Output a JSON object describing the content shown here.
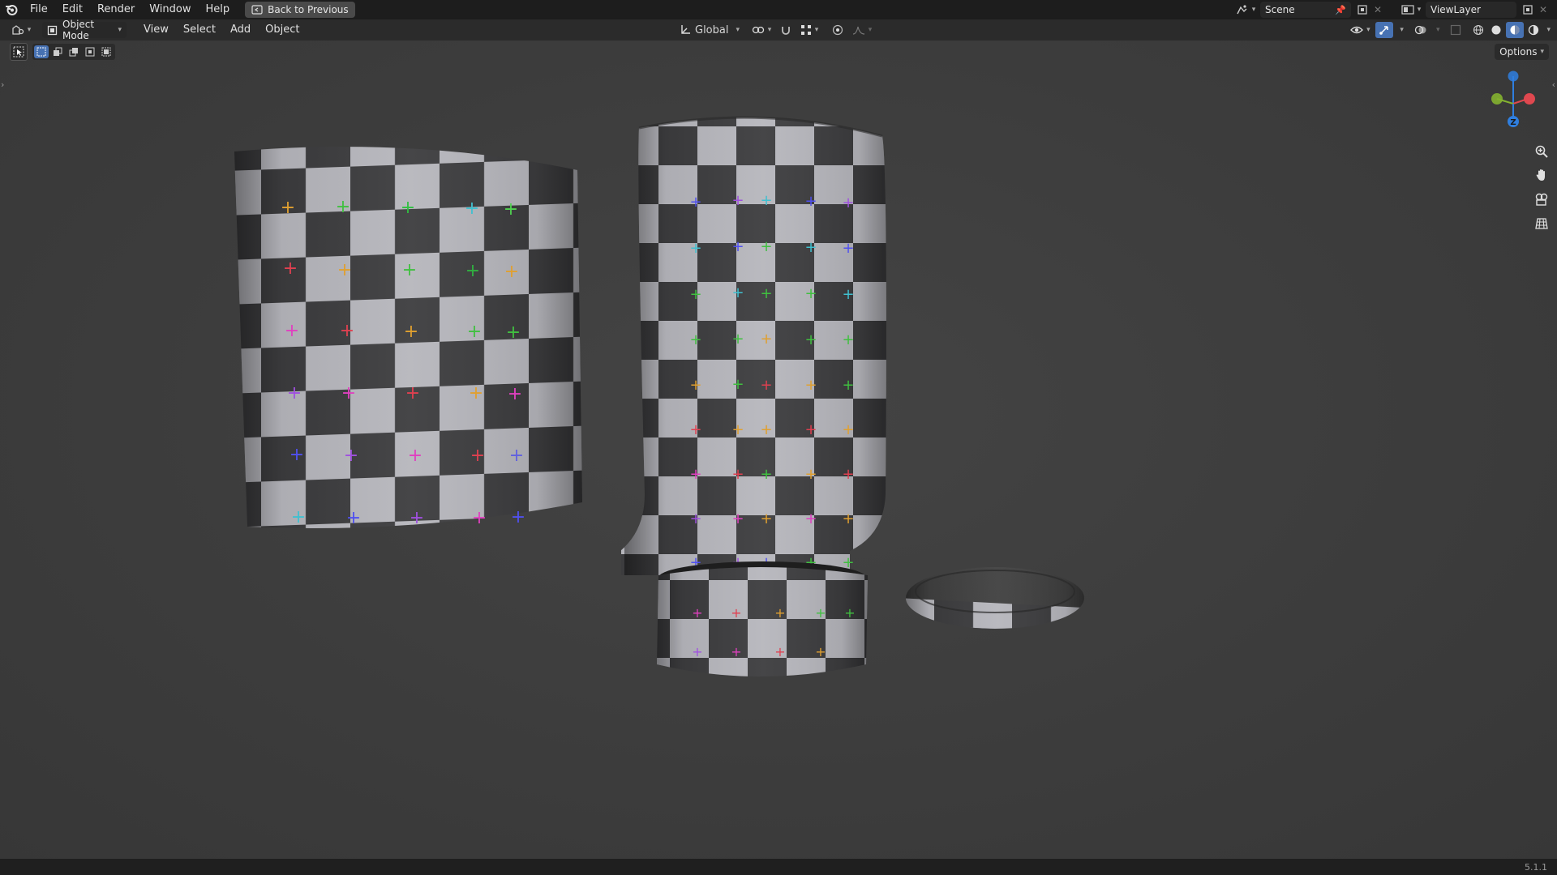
{
  "topbar": {
    "menu": [
      "File",
      "Edit",
      "Render",
      "Window",
      "Help"
    ],
    "back_button_label": "Back to Previous",
    "scene_name": "Scene",
    "view_layer_name": "ViewLayer"
  },
  "header": {
    "mode_label": "Object Mode",
    "menu": [
      "View",
      "Select",
      "Add",
      "Object"
    ],
    "orientation_label": "Global",
    "options_label": "Options"
  },
  "gizmo": {
    "z_label": "Z",
    "x_color": "#e0484f",
    "y_color": "#84b330",
    "z_color": "#2f7fe0"
  },
  "status": {
    "version": "5.1.1"
  },
  "colors": {
    "topbar_bg": "#1d1d1d",
    "header_bg": "#2b2b2b",
    "viewport_bg": "#3d3d3d",
    "checker_light": "#b9b9bf",
    "checker_dark": "#3c3c3e"
  },
  "icons": [
    "blender-logo-icon",
    "back-icon",
    "scene-icon",
    "pin-icon",
    "new-scene-icon",
    "view-layer-icon",
    "editor-type-icon",
    "object-mode-icon",
    "transform-orientation-icon",
    "pivot-icon",
    "snap-icon",
    "proportional-edit-icon",
    "visibility-icon",
    "gizmo-icon",
    "overlay-icon",
    "xray-icon",
    "wireframe-shading-icon",
    "solid-shading-icon",
    "material-shading-icon",
    "rendered-shading-icon",
    "select-box-icon",
    "zoom-icon",
    "hand-icon",
    "camera-icon",
    "grid-icon"
  ]
}
